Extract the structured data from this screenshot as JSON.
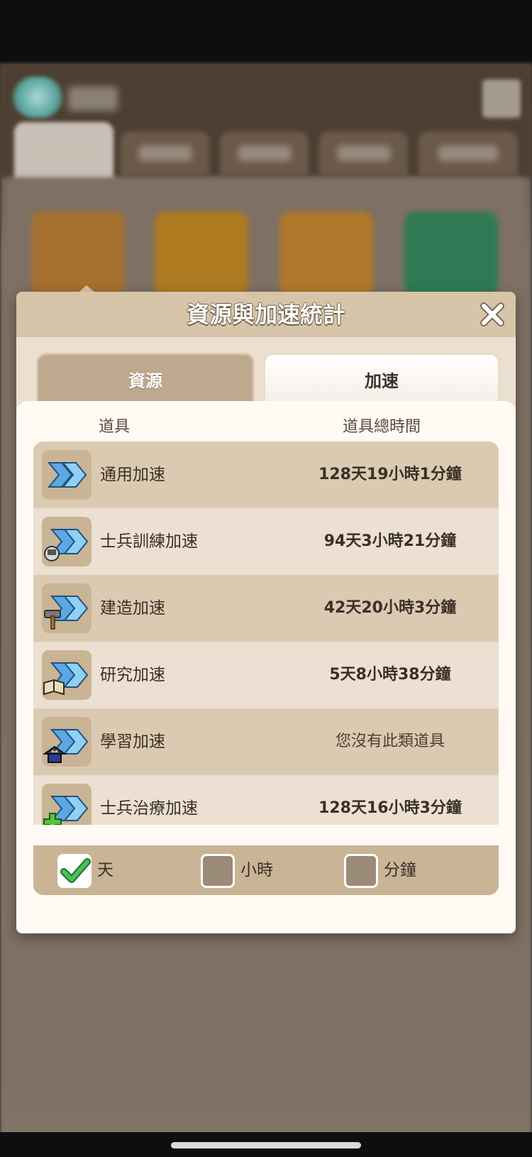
{
  "dialog": {
    "title": "資源與加速統計",
    "tabs": {
      "resources": "資源",
      "speedup": "加速",
      "active": "speedup"
    }
  },
  "columns": {
    "item": "道具",
    "total_time": "道具總時間"
  },
  "speedups": [
    {
      "icon": "general-speedup-icon",
      "name": "通用加速",
      "time": "128天19小時1分鐘"
    },
    {
      "icon": "training-speedup-icon",
      "name": "士兵訓練加速",
      "time": "94天3小時21分鐘"
    },
    {
      "icon": "building-speedup-icon",
      "name": "建造加速",
      "time": "42天20小時3分鐘"
    },
    {
      "icon": "research-speedup-icon",
      "name": "研究加速",
      "time": "5天8小時38分鐘"
    },
    {
      "icon": "learning-speedup-icon",
      "name": "學習加速",
      "time": "您沒有此類道具"
    },
    {
      "icon": "healing-speedup-icon",
      "name": "士兵治療加速",
      "time": "128天16小時3分鐘"
    }
  ],
  "filters": [
    {
      "label": "天",
      "checked": true
    },
    {
      "label": "小時",
      "checked": false
    },
    {
      "label": "分鐘",
      "checked": false
    }
  ]
}
